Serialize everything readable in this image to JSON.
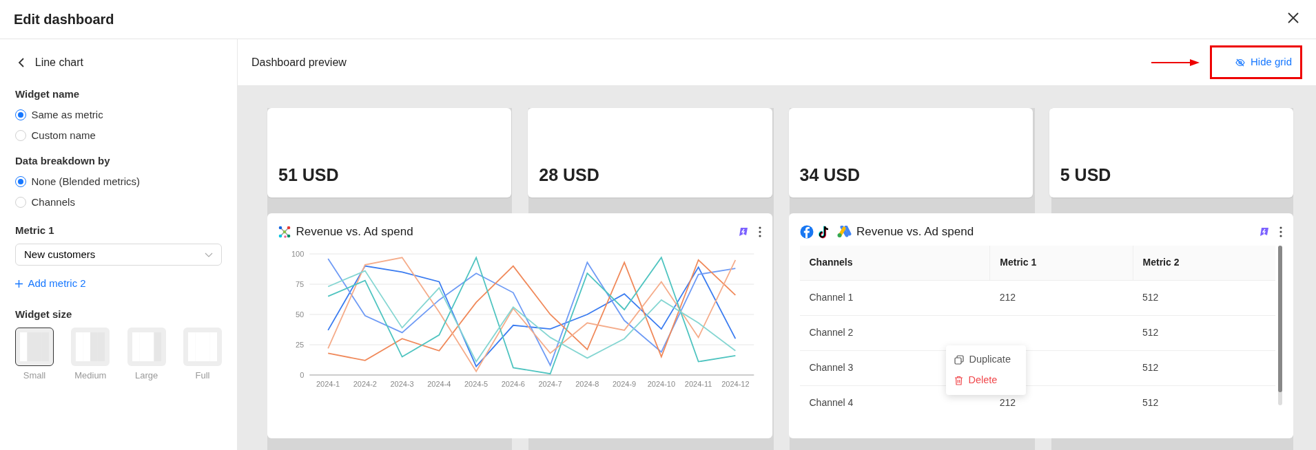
{
  "window": {
    "title": "Edit dashboard"
  },
  "editor": {
    "heading": "Line chart",
    "widget_name": {
      "label": "Widget name",
      "options": [
        {
          "label": "Same as metric",
          "selected": true
        },
        {
          "label": "Custom name",
          "selected": false
        }
      ]
    },
    "breakdown": {
      "label": "Data breakdown by",
      "options": [
        {
          "label": "None (Blended metrics)",
          "selected": true
        },
        {
          "label": "Channels",
          "selected": false
        }
      ]
    },
    "metric_1": {
      "label": "Metric 1",
      "value": "New customers"
    },
    "add_metric": "Add metric 2",
    "widget_size": {
      "label": "Widget size",
      "options": [
        {
          "label": "Small",
          "kind": "small",
          "selected": true
        },
        {
          "label": "Medium",
          "kind": "medium",
          "selected": false
        },
        {
          "label": "Large",
          "kind": "large",
          "selected": false
        },
        {
          "label": "Full",
          "kind": "full",
          "selected": false
        }
      ]
    }
  },
  "preview": {
    "title": "Dashboard preview",
    "hide_grid": "Hide grid",
    "kpis": [
      {
        "value": "51 USD"
      },
      {
        "value": "28 USD"
      },
      {
        "value": "34 USD"
      },
      {
        "value": "5 USD"
      }
    ],
    "widgets": [
      {
        "kind": "chart",
        "title": "Revenue vs. Ad spend",
        "chart_data": {
          "type": "line",
          "grid": true,
          "categories": [
            "2024-1",
            "2024-2",
            "2024-3",
            "2024-4",
            "2024-5",
            "2024-6",
            "2024-7",
            "2024-8",
            "2024-9",
            "2024-10",
            "2024-11",
            "2024-12"
          ],
          "ylim": [
            0,
            100
          ],
          "yticks": [
            0,
            25,
            50,
            75,
            100
          ],
          "series": [
            {
              "color": "#3b7cf0",
              "values": [
                37,
                90,
                85,
                77,
                7,
                41,
                38,
                50,
                67,
                38,
                89,
                30
              ]
            },
            {
              "color": "#6f9bf5",
              "values": [
                96,
                49,
                35,
                62,
                84,
                68,
                8,
                93,
                45,
                19,
                83,
                88
              ]
            },
            {
              "color": "#f0895a",
              "values": [
                18,
                12,
                30,
                20,
                60,
                90,
                50,
                21,
                93,
                15,
                95,
                66
              ]
            },
            {
              "color": "#f5ac8a",
              "values": [
                22,
                91,
                97,
                52,
                3,
                55,
                18,
                43,
                37,
                77,
                31,
                95
              ]
            },
            {
              "color": "#4fc4c0",
              "values": [
                65,
                78,
                15,
                33,
                97,
                6,
                1,
                84,
                54,
                97,
                11,
                16
              ]
            },
            {
              "color": "#85d6d2",
              "values": [
                73,
                86,
                39,
                72,
                11,
                56,
                31,
                14,
                30,
                62,
                43,
                20
              ]
            }
          ]
        }
      },
      {
        "kind": "table",
        "title": "Revenue vs. Ad spend",
        "columns": [
          "Channels",
          "Metric 1",
          "Metric 2"
        ],
        "rows": [
          {
            "channel": "Channel 1",
            "metric_1": "212",
            "metric_2": "512"
          },
          {
            "channel": "Channel 2",
            "metric_2": "512"
          },
          {
            "channel": "Channel 3",
            "metric_2": "512"
          },
          {
            "channel": "Channel 4",
            "metric_1": "212",
            "metric_2": "512"
          }
        ],
        "context_menu": [
          {
            "label": "Duplicate",
            "kind": "duplicate"
          },
          {
            "label": "Delete",
            "kind": "delete"
          }
        ]
      }
    ]
  }
}
